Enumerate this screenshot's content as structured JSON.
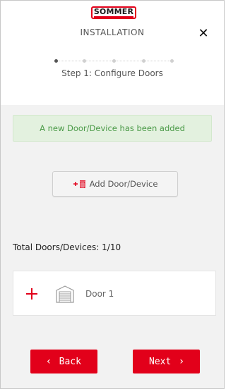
{
  "brand": {
    "logo_text": "SOMMER",
    "accent_color": "#e2001a"
  },
  "header": {
    "title": "INSTALLATION",
    "close_icon": "close-icon"
  },
  "stepper": {
    "total_steps": 5,
    "current_step": 1,
    "label": "Step 1: Configure Doors"
  },
  "alert": {
    "message": "A new Door/Device has been added",
    "color": "#4a9a47"
  },
  "add_button": {
    "label": "Add Door/Device",
    "icon": "add-trash-icon"
  },
  "total": {
    "label": "Total Doors/Devices: 1/10"
  },
  "doors": [
    {
      "name": "Door 1",
      "icon": "garage-door-icon"
    }
  ],
  "nav": {
    "back_label": "Back",
    "next_label": "Next"
  }
}
